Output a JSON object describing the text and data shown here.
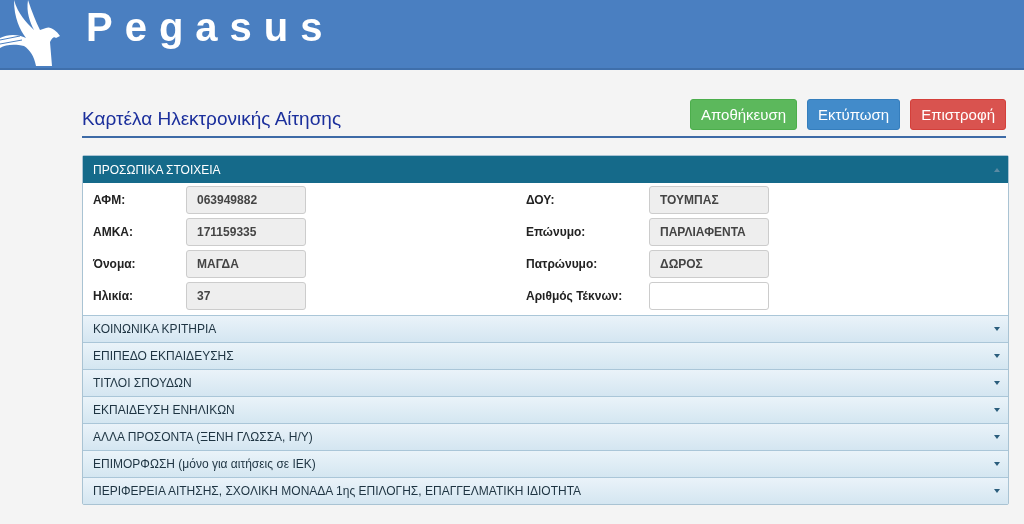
{
  "header": {
    "brand": "Pegasus"
  },
  "page": {
    "title": "Καρτέλα Ηλεκτρονικής Αίτησης"
  },
  "buttons": [
    {
      "label": "Αποθήκευση",
      "kind": "success"
    },
    {
      "label": "Εκτύπωση",
      "kind": "primary"
    },
    {
      "label": "Επιστροφή",
      "kind": "danger"
    }
  ],
  "sections": [
    {
      "title": "ΠΡΟΣΩΠΙΚΑ ΣΤΟΙΧΕΙΑ",
      "expanded": true,
      "fields": [
        {
          "label": "ΑΦΜ:",
          "value": "063949882",
          "disabled": true
        },
        {
          "label": "ΔΟΥ:",
          "value": "ΤΟΥΜΠΑΣ",
          "disabled": true
        },
        {
          "label": "ΑΜΚΑ:",
          "value": "171159335",
          "disabled": true
        },
        {
          "label": "Επώνυμο:",
          "value": "ΠΑΡΛΙΑΦΕΝΤΑ",
          "disabled": true
        },
        {
          "label": "Όνομα:",
          "value": "ΜΑΓΔΑ",
          "disabled": true
        },
        {
          "label": "Πατρώνυμο:",
          "value": "ΔΩΡΟΣ",
          "disabled": true
        },
        {
          "label": "Ηλικία:",
          "value": "37",
          "disabled": true
        },
        {
          "label": "Αριθμός Τέκνων:",
          "disabled": false
        }
      ]
    },
    {
      "title": "ΚΟΙΝΩΝΙΚΑ ΚΡΙΤΗΡΙΑ",
      "expanded": false
    },
    {
      "title": "ΕΠΙΠΕΔΟ ΕΚΠΑΙΔΕΥΣΗΣ",
      "expanded": false
    },
    {
      "title": "ΤΙΤΛΟΙ ΣΠΟΥΔΩΝ",
      "expanded": false
    },
    {
      "title": "ΕΚΠΑΙΔΕΥΣΗ ΕΝΗΛΙΚΩΝ",
      "expanded": false
    },
    {
      "title": "ΑΛΛΑ ΠΡΟΣΟΝΤΑ (ΞΕΝΗ ΓΛΩΣΣΑ, Η/Υ)",
      "expanded": false
    },
    {
      "title": "ΕΠΙΜΟΡΦΩΣΗ (μόνο για αιτήσεις σε ΙΕΚ)",
      "expanded": false
    },
    {
      "title": "ΠΕΡΙΦΕΡΕΙΑ ΑΙΤΗΣΗΣ, ΣΧΟΛΙΚΗ ΜΟΝΑΔΑ 1ης ΕΠΙΛΟΓΗΣ, ΕΠΑΓΓΕΛΜΑΤΙΚΗ ΙΔΙΟΤΗΤΑ",
      "expanded": false
    }
  ]
}
